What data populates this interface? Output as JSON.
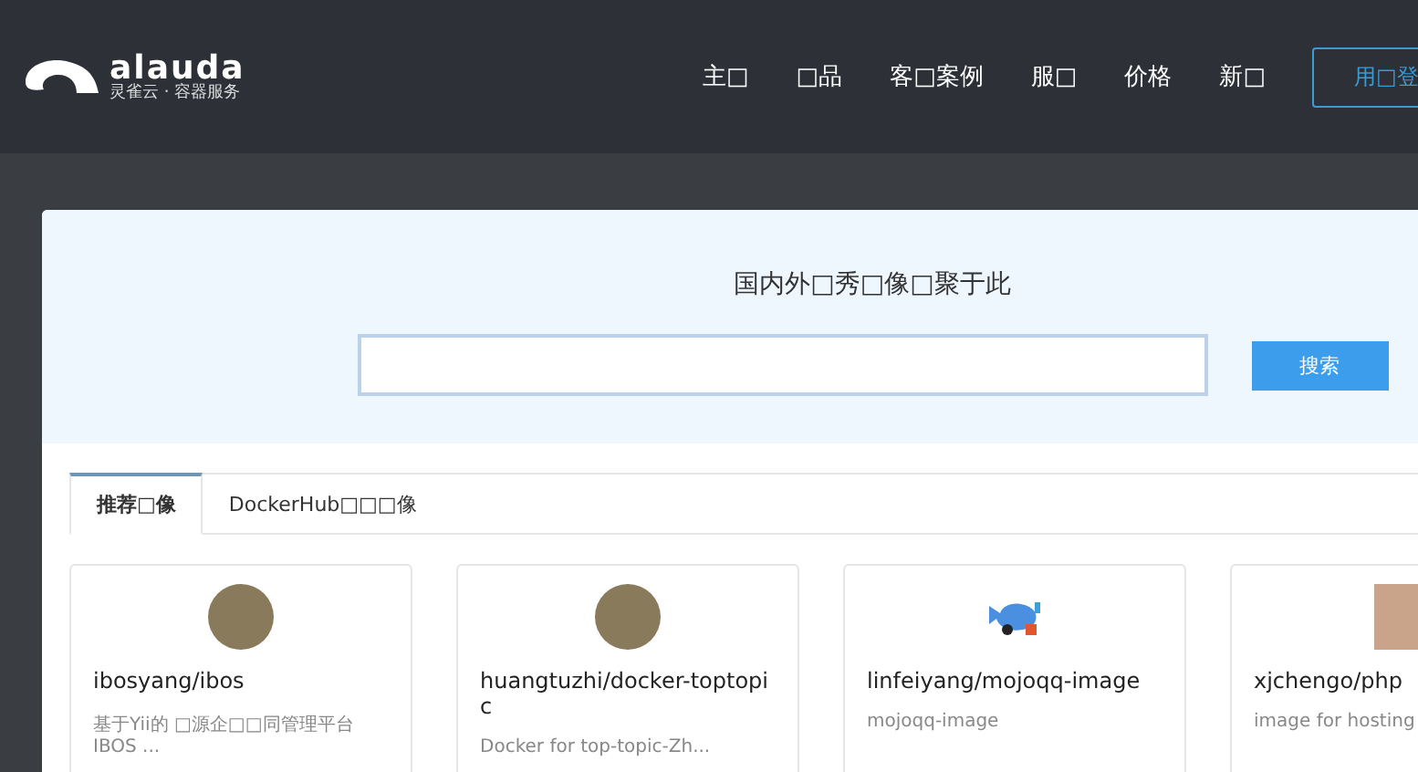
{
  "header": {
    "logo_text": "alauda",
    "logo_subtitle": "灵雀云 · 容器服务",
    "nav": [
      {
        "label": "主□"
      },
      {
        "label": "□品"
      },
      {
        "label": "客□案例"
      },
      {
        "label": "服□"
      },
      {
        "label": "价格"
      },
      {
        "label": "新□"
      }
    ],
    "login_button": "用□登"
  },
  "hero": {
    "title": "国内外□秀□像□聚于此",
    "search_button": "搜索"
  },
  "tabs": [
    {
      "label": "推荐□像",
      "selected": true
    },
    {
      "label": "DockerHub□□□像",
      "selected": false
    }
  ],
  "cards": [
    {
      "kind": "circle",
      "name": "ibosyang/ibos",
      "description": "基于Yii的 □源企□□同管理平台 IBOS ..."
    },
    {
      "kind": "circle",
      "name": "huangtuzhi/docker-toptopic",
      "description": "Docker for top-topic-Zh..."
    },
    {
      "kind": "whale",
      "name": "linfeiyang/mojoqq-image",
      "description": "mojoqq-image"
    },
    {
      "kind": "photo",
      "name": "xjchengo/php",
      "description": "image for hosting"
    }
  ]
}
